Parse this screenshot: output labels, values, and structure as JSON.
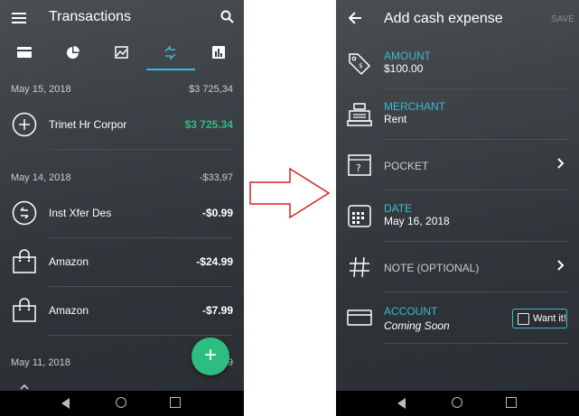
{
  "left_screen": {
    "title": "Transactions",
    "icons": {
      "menu": "menu-icon",
      "search": "search-icon"
    },
    "tabs": [
      {
        "icon": "card-icon",
        "active": false
      },
      {
        "icon": "pie-chart-icon",
        "active": false
      },
      {
        "icon": "image-chart-icon",
        "active": false
      },
      {
        "icon": "transfer-icon",
        "active": true
      },
      {
        "icon": "bar-chart-icon",
        "active": false
      }
    ],
    "groups": [
      {
        "date": "May 15, 2018",
        "total": "$3 725,34",
        "items": [
          {
            "icon": "plus-circle-icon",
            "name": "Trinet Hr Corpor",
            "amount": "$3 725.34",
            "positive": true
          }
        ]
      },
      {
        "date": "May 14, 2018",
        "total": "-$33,97",
        "items": [
          {
            "icon": "transfer-circle-icon",
            "name": "Inst Xfer Des",
            "amount": "-$0.99",
            "positive": false
          },
          {
            "icon": "shopping-bag-icon",
            "name": "Amazon",
            "amount": "-$24.99",
            "positive": false
          },
          {
            "icon": "shopping-bag-icon",
            "name": "Amazon",
            "amount": "-$7.99",
            "positive": false
          }
        ]
      },
      {
        "date": "May 11, 2018",
        "total": "9",
        "items": []
      }
    ],
    "fab_label": "+",
    "colors": {
      "positive": "#2ebd80",
      "accent": "#3ab9d4",
      "fab": "#2ebd80"
    }
  },
  "arrow_icon": "right-arrow-icon",
  "right_screen": {
    "title": "Add cash expense",
    "save_label": "SAVE",
    "fields": {
      "amount": {
        "label": "AMOUNT",
        "value": "$100.00",
        "icon": "price-tag-icon"
      },
      "merchant": {
        "label": "MERCHANT",
        "value": "Rent",
        "icon": "cash-register-icon"
      },
      "pocket": {
        "label": "POCKET",
        "icon": "pocket-box-icon"
      },
      "date": {
        "label": "DATE",
        "value": "May 16, 2018",
        "icon": "calendar-icon"
      },
      "note": {
        "label": "NOTE (OPTIONAL)",
        "icon": "hash-icon"
      },
      "account": {
        "label": "ACCOUNT",
        "value": "Coming Soon",
        "icon": "credit-card-icon"
      }
    },
    "want_it_label": "Want it!",
    "colors": {
      "label": "#3ab9d4",
      "checkbox_border": "#3ab9d4"
    }
  },
  "system_nav": {
    "back": "back-icon",
    "home": "home-icon",
    "recents": "recents-icon"
  }
}
